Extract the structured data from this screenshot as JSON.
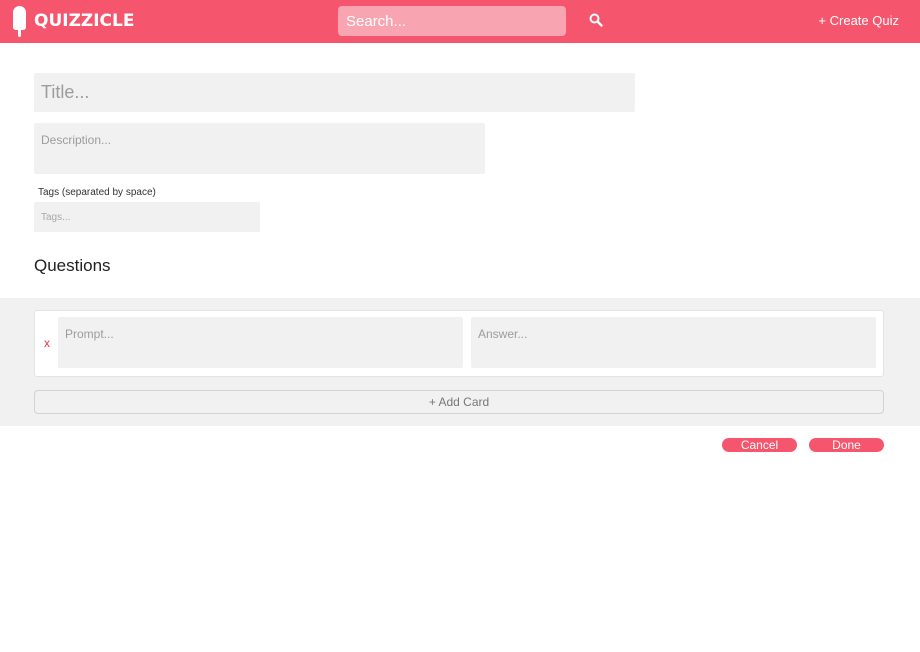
{
  "header": {
    "brand": "QUIZZICLE",
    "search_placeholder": "Search...",
    "create_quiz_label": "+ Create Quiz",
    "search_icon": "search-icon",
    "logo_icon": "popsicle-icon"
  },
  "form": {
    "title_placeholder": "Title...",
    "description_placeholder": "Description...",
    "tags_label": "Tags (separated by space)",
    "tags_placeholder": "Tags...",
    "questions_heading": "Questions"
  },
  "cards": [
    {
      "delete_label": "x",
      "prompt_placeholder": "Prompt...",
      "answer_placeholder": "Answer..."
    }
  ],
  "add_card_label": "+ Add Card",
  "actions": {
    "cancel_label": "Cancel",
    "done_label": "Done"
  },
  "colors": {
    "accent": "#f5556d",
    "search_bg": "#f8a5b1",
    "field_bg": "#f1f1f1",
    "delete_red": "#e8364f"
  }
}
